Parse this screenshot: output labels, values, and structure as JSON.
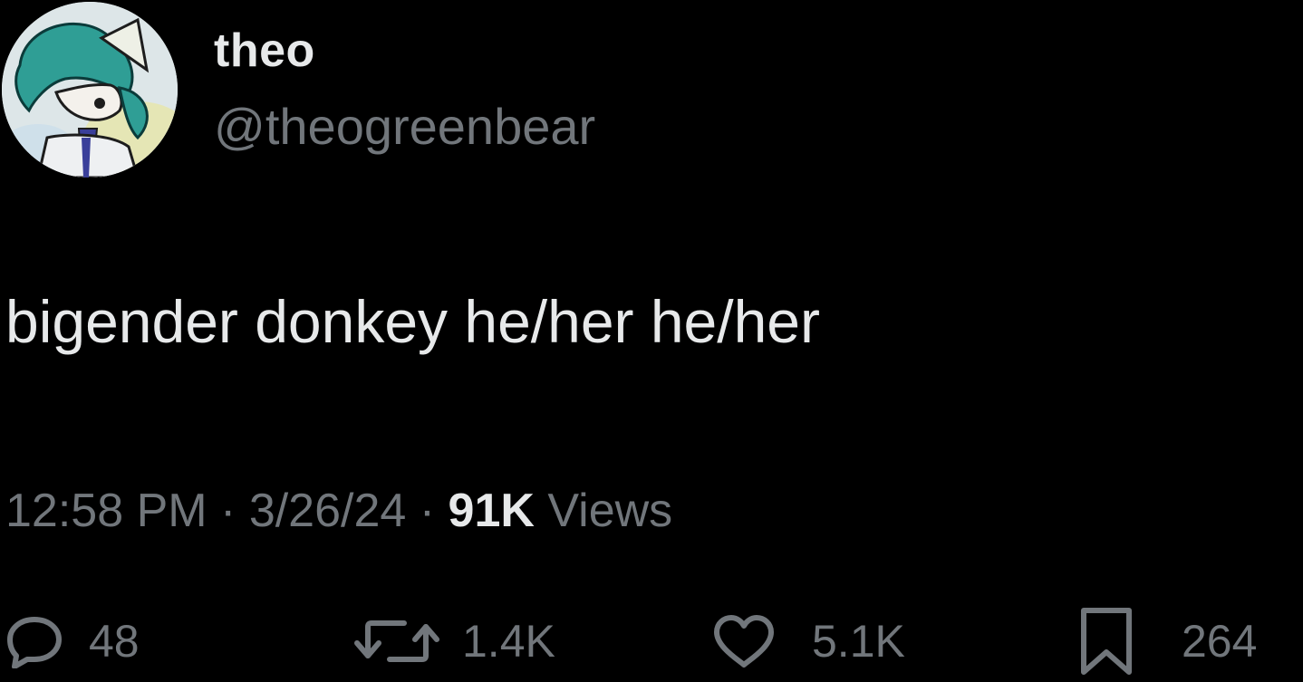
{
  "author": {
    "display_name": "theo",
    "handle": "@theogreenbear",
    "avatar_icon": "avatar-image"
  },
  "tweet": {
    "text": "bigender donkey he/her he/her",
    "time": "12:58 PM",
    "separator": "·",
    "date": "3/26/24",
    "views_count": "91K",
    "views_label": "Views"
  },
  "actions": {
    "replies": "48",
    "reposts": "1.4K",
    "likes": "5.1K",
    "bookmarks": "264"
  },
  "colors": {
    "background": "#000000",
    "primary_text": "#e7e9ea",
    "secondary_text": "#71767b"
  }
}
